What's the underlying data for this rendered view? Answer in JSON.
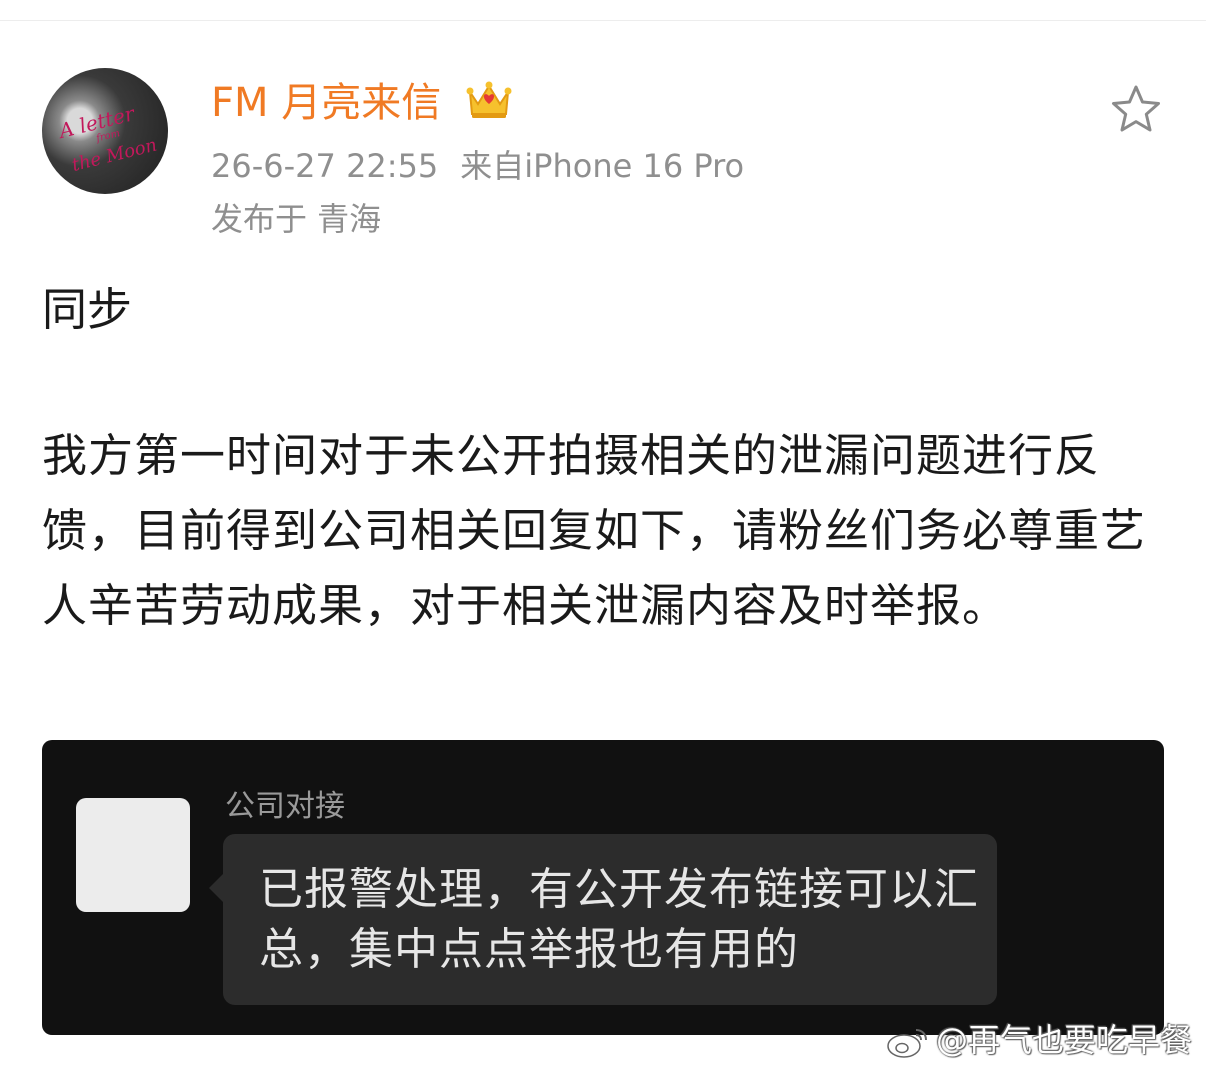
{
  "post": {
    "author": {
      "name": "FM 月亮来信",
      "avatar_text": "A letter from the Moon"
    },
    "timestamp": "26-6-27 22:55",
    "source": "来自iPhone 16 Pro",
    "location": "发布于 青海",
    "heading": "同步",
    "body": "我方第一时间对于未公开拍摄相关的泄漏问题进行反馈，目前得到公司相关回复如下，请粉丝们务必尊重艺人辛苦劳动成果，对于相关泄漏内容及时举报。"
  },
  "screenshot": {
    "sender_name": "公司对接",
    "message": "已报警处理，有公开发布链接可以汇总，集中点点举报也有用的"
  },
  "watermark": "@再气也要吃早餐",
  "icons": {
    "favorite": "star-outline-icon",
    "badge": "crown-icon",
    "platform": "weibo-logo-icon"
  },
  "colors": {
    "username": "#f07a24",
    "meta": "#8f8f8f",
    "text": "#1a1a1a",
    "card_bg": "#111111",
    "bubble_bg": "#2c2c2c"
  }
}
